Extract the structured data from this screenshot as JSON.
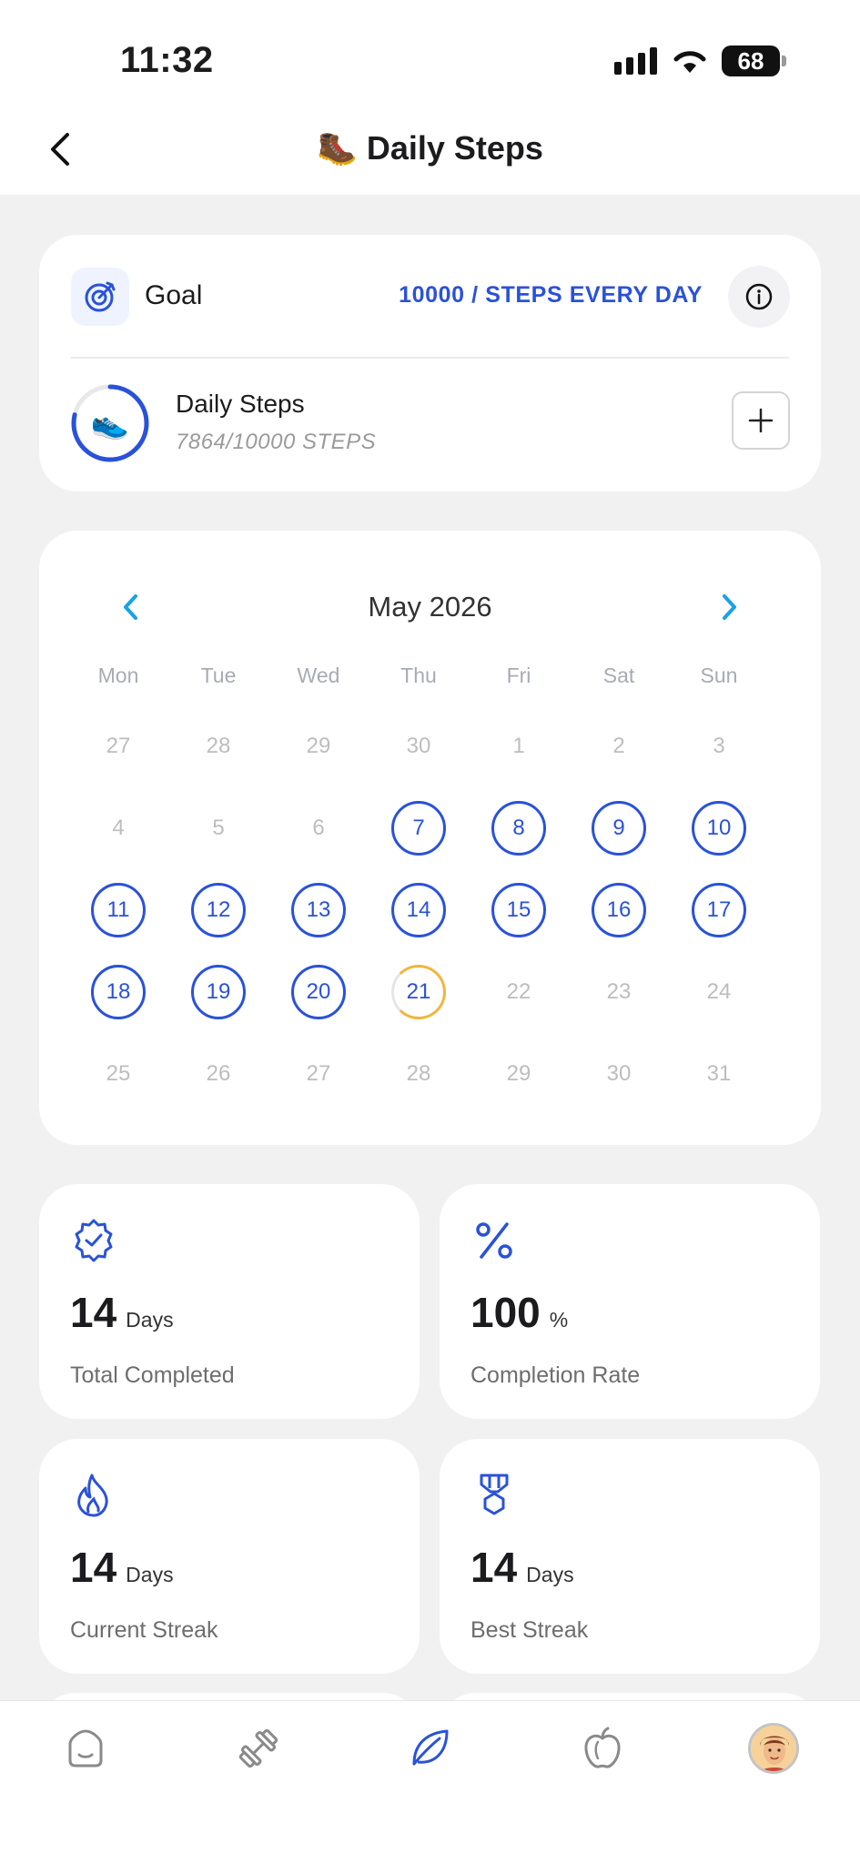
{
  "status_bar": {
    "time": "11:32",
    "battery": "68"
  },
  "nav": {
    "title": "Daily Steps",
    "title_icon": "🥾"
  },
  "goal": {
    "label": "Goal",
    "value": "10000 / STEPS EVERY DAY",
    "progress": 0.7864,
    "item_icon": "👟",
    "item_title": "Daily Steps",
    "item_subtitle": "7864/10000 STEPS"
  },
  "calendar": {
    "month": "May 2026",
    "weekdays": [
      "Mon",
      "Tue",
      "Wed",
      "Thu",
      "Fri",
      "Sat",
      "Sun"
    ],
    "days": [
      {
        "d": "27",
        "s": "muted"
      },
      {
        "d": "28",
        "s": "muted"
      },
      {
        "d": "29",
        "s": "muted"
      },
      {
        "d": "30",
        "s": "muted"
      },
      {
        "d": "1",
        "s": "muted"
      },
      {
        "d": "2",
        "s": "muted"
      },
      {
        "d": "3",
        "s": "muted"
      },
      {
        "d": "4",
        "s": "muted"
      },
      {
        "d": "5",
        "s": "muted"
      },
      {
        "d": "6",
        "s": "muted"
      },
      {
        "d": "7",
        "s": "done"
      },
      {
        "d": "8",
        "s": "done"
      },
      {
        "d": "9",
        "s": "done"
      },
      {
        "d": "10",
        "s": "done"
      },
      {
        "d": "11",
        "s": "done"
      },
      {
        "d": "12",
        "s": "done"
      },
      {
        "d": "13",
        "s": "done"
      },
      {
        "d": "14",
        "s": "done"
      },
      {
        "d": "15",
        "s": "done"
      },
      {
        "d": "16",
        "s": "done"
      },
      {
        "d": "17",
        "s": "done"
      },
      {
        "d": "18",
        "s": "done"
      },
      {
        "d": "19",
        "s": "done"
      },
      {
        "d": "20",
        "s": "done"
      },
      {
        "d": "21",
        "s": "today"
      },
      {
        "d": "22",
        "s": "muted"
      },
      {
        "d": "23",
        "s": "muted"
      },
      {
        "d": "24",
        "s": "muted"
      },
      {
        "d": "25",
        "s": "muted"
      },
      {
        "d": "26",
        "s": "muted"
      },
      {
        "d": "27",
        "s": "muted"
      },
      {
        "d": "28",
        "s": "muted"
      },
      {
        "d": "29",
        "s": "muted"
      },
      {
        "d": "30",
        "s": "muted"
      },
      {
        "d": "31",
        "s": "muted"
      }
    ]
  },
  "stats": {
    "total": {
      "value": "14",
      "unit": "Days",
      "label": "Total Completed",
      "icon": "badge-check-icon"
    },
    "rate": {
      "value": "100",
      "unit": "%",
      "label": "Completion Rate",
      "icon": "percent-icon"
    },
    "current": {
      "value": "14",
      "unit": "Days",
      "label": "Current Streak",
      "icon": "flame-icon"
    },
    "best": {
      "value": "14",
      "unit": "Days",
      "label": "Best Streak",
      "icon": "medal-icon"
    }
  },
  "tabs": [
    "home-icon",
    "dumbbell-icon",
    "leaf-icon",
    "apple-icon",
    "profile-avatar"
  ],
  "colors": {
    "accent": "#2a52d8",
    "today": "#f1b63c",
    "nav_arrow": "#1aa1e6"
  }
}
